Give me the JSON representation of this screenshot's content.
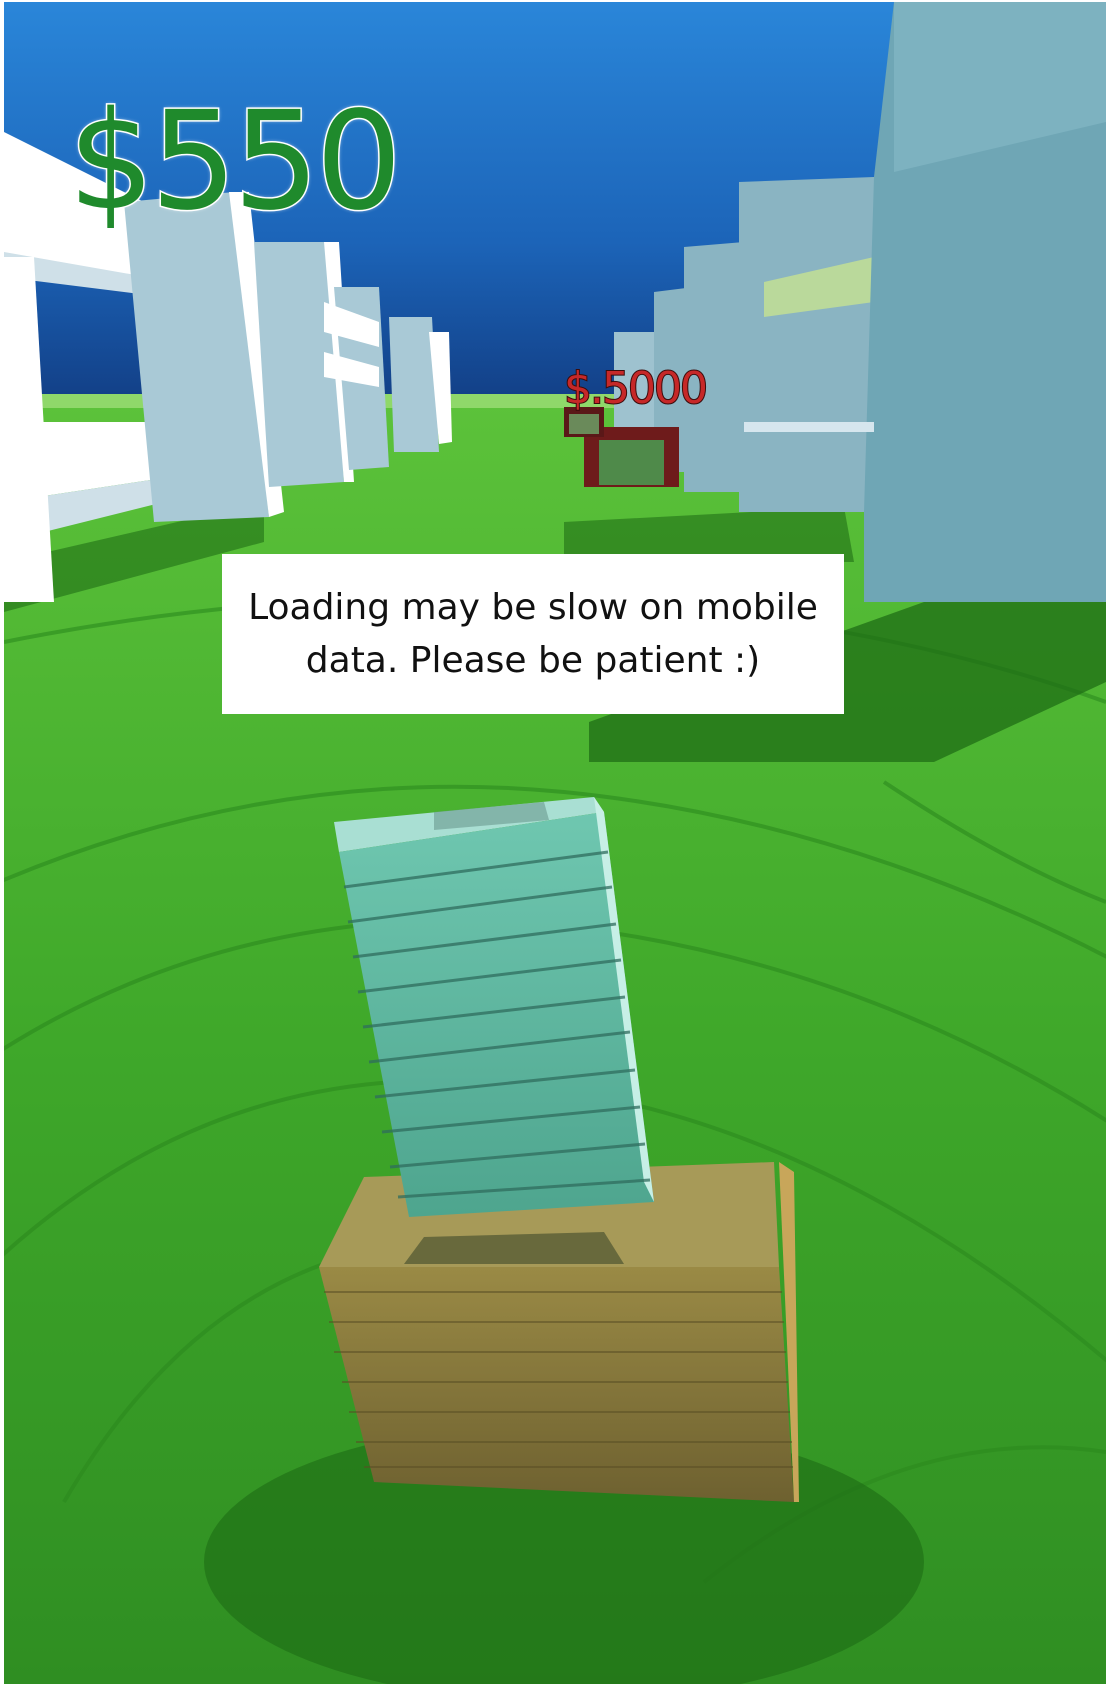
{
  "hud": {
    "money": "$550"
  },
  "gate": {
    "label": "$.5000"
  },
  "notice": {
    "text": "Loading may be slow on mobile data. Please be patient :)"
  },
  "colors": {
    "sky": "#1f6fc4",
    "grass": "#3fa82a",
    "money_text": "#1f8a2c",
    "gate_text": "#c62828",
    "building": "#d6e6ee",
    "cash_stack": "#5bb39c",
    "crate": "#8a7a3c"
  },
  "icons": [
    "cash-stack-icon",
    "crate-icon"
  ]
}
